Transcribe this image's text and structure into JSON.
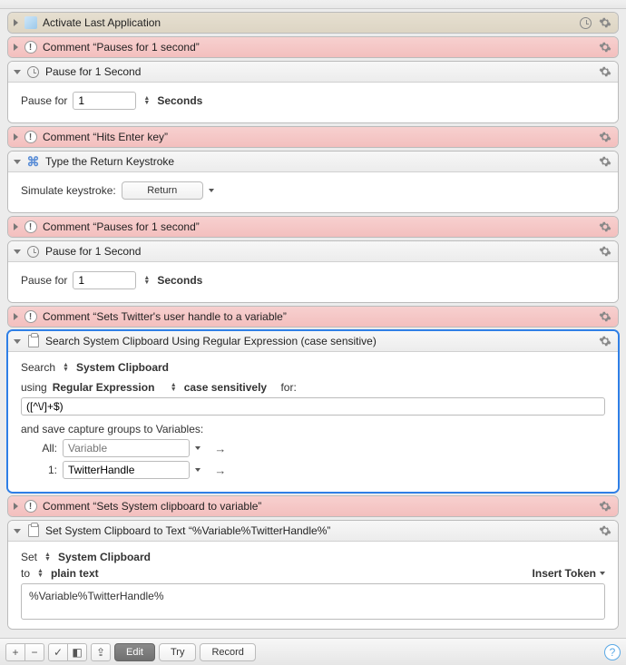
{
  "actions": [
    {
      "title": "Activate Last Application"
    },
    {
      "title": "Comment “Pauses for 1 second”"
    },
    {
      "title": "Pause for 1 Second",
      "pause_label": "Pause for",
      "pause_value": "1",
      "pause_unit": "Seconds"
    },
    {
      "title": "Comment “Hits Enter key”"
    },
    {
      "title": "Type the Return Keystroke",
      "sim_label": "Simulate keystroke:",
      "sim_value": "Return"
    },
    {
      "title": "Comment “Pauses for 1 second”"
    },
    {
      "title": "Pause for 1 Second",
      "pause_label": "Pause for",
      "pause_value": "1",
      "pause_unit": "Seconds"
    },
    {
      "title": "Comment “Sets Twitter's user handle to a variable”"
    },
    {
      "title": "Search System Clipboard Using Regular Expression (case sensitive)",
      "search_label": "Search",
      "search_target": "System Clipboard",
      "using_prefix": "using",
      "using_mode": "Regular Expression",
      "case_mode": "case sensitively",
      "for_label": "for:",
      "regex_value": "([^\\/]+$)",
      "save_label": "and save capture groups to Variables:",
      "cap_all_label": "All:",
      "cap_all_placeholder": "Variable",
      "cap_1_label": "1:",
      "cap_1_value": "TwitterHandle"
    },
    {
      "title": "Comment “Sets System clipboard to variable”"
    },
    {
      "title": "Set System Clipboard to Text “%Variable%TwitterHandle%”",
      "set_label": "Set",
      "set_target": "System Clipboard",
      "to_label": "to",
      "to_format": "plain text",
      "insert_token": "Insert Token",
      "text_value": "%Variable%TwitterHandle%"
    }
  ],
  "toolbar": {
    "edit": "Edit",
    "try": "Try",
    "record": "Record"
  }
}
